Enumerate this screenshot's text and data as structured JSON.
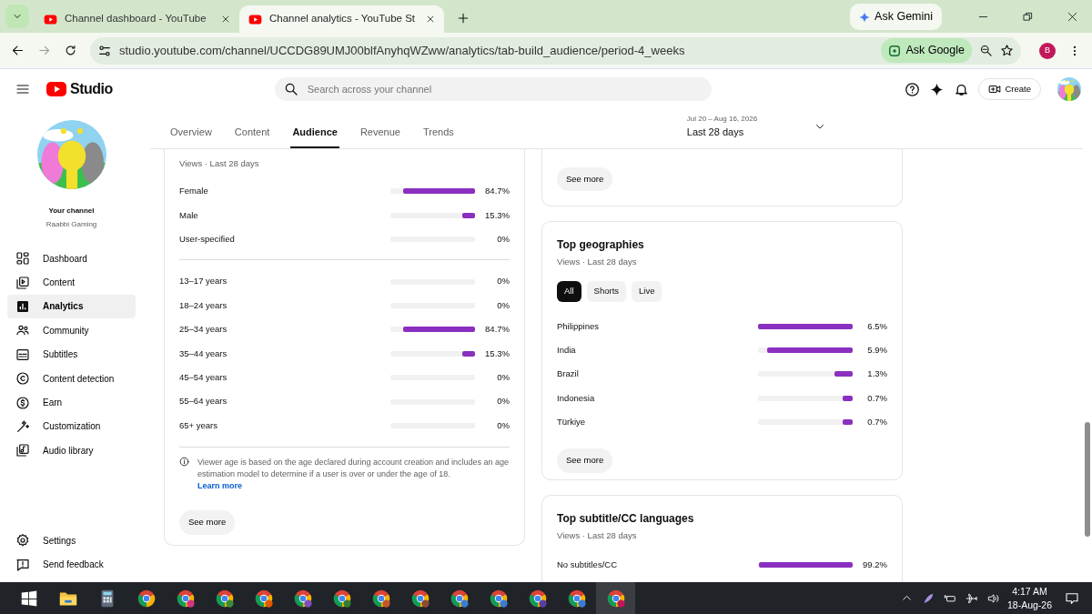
{
  "browser": {
    "tabs": [
      {
        "title": "Channel dashboard - YouTube",
        "selected": false
      },
      {
        "title": "Channel analytics - YouTube St",
        "selected": true
      }
    ],
    "url": "studio.youtube.com/channel/UCCDG89UMJ00blfAnyhqWZww/analytics/tab-build_audience/period-4_weeks",
    "ask_gemini": "Ask Gemini",
    "ask_google": "Ask Google",
    "profile_initial": "B"
  },
  "studio": {
    "logo": "Studio",
    "search": {
      "placeholder": "Search across your channel"
    },
    "create": "Create"
  },
  "sidebar": {
    "channel_label": "Your channel",
    "channel_name": "Raabbi Gaming",
    "items": [
      {
        "label": "Dashboard",
        "selected": false
      },
      {
        "label": "Content",
        "selected": false
      },
      {
        "label": "Analytics",
        "selected": true
      },
      {
        "label": "Community",
        "selected": false
      },
      {
        "label": "Subtitles",
        "selected": false
      },
      {
        "label": "Content detection",
        "selected": false
      },
      {
        "label": "Earn",
        "selected": false
      },
      {
        "label": "Customization",
        "selected": false
      },
      {
        "label": "Audio library",
        "selected": false
      }
    ],
    "footer_items": [
      "Settings",
      "Send feedback"
    ]
  },
  "analytics_tabs": [
    {
      "label": "Overview",
      "selected": false
    },
    {
      "label": "Content",
      "selected": false
    },
    {
      "label": "Audience",
      "selected": true
    },
    {
      "label": "Revenue",
      "selected": false
    },
    {
      "label": "Trends",
      "selected": false
    }
  ],
  "date_range": {
    "range": "Jul 20 – Aug 16, 2026",
    "label": "Last 28 days"
  },
  "age_gender": {
    "subtitle": "Views · Last 28 days",
    "gender": [
      {
        "label": "Female",
        "value": "84.7%",
        "level": 0.847
      },
      {
        "label": "Male",
        "value": "15.3%",
        "level": 0.153
      },
      {
        "label": "User-specified",
        "value": "0%",
        "level": 0
      }
    ],
    "ages": [
      {
        "label": "13–17 years",
        "value": "0%",
        "level": 0
      },
      {
        "label": "18–24 years",
        "value": "0%",
        "level": 0
      },
      {
        "label": "25–34 years",
        "value": "84.7%",
        "level": 0.847
      },
      {
        "label": "35–44 years",
        "value": "15.3%",
        "level": 0.153
      },
      {
        "label": "45–54 years",
        "value": "0%",
        "level": 0
      },
      {
        "label": "55–64 years",
        "value": "0%",
        "level": 0
      },
      {
        "label": "65+ years",
        "value": "0%",
        "level": 0
      }
    ],
    "note": "Viewer age is based on the age declared during account creation and includes an age estimation model to determine if a user is over or under the age of 18.",
    "learn_more": "Learn more",
    "see_more": "See more"
  },
  "upper_card": {
    "see_more": "See more"
  },
  "geographies": {
    "title": "Top geographies",
    "subtitle": "Views · Last 28 days",
    "filters": [
      {
        "label": "All",
        "selected": true
      },
      {
        "label": "Shorts",
        "selected": false
      },
      {
        "label": "Live",
        "selected": false
      }
    ],
    "rows": [
      {
        "label": "Philippines",
        "value": "6.5%",
        "level": 1
      },
      {
        "label": "India",
        "value": "5.9%",
        "level": 0.9
      },
      {
        "label": "Brazil",
        "value": "1.3%",
        "level": 0.19
      },
      {
        "label": "Indonesia",
        "value": "0.7%",
        "level": 0.11
      },
      {
        "label": "Türkiye",
        "value": "0.7%",
        "level": 0.11
      }
    ],
    "see_more": "See more"
  },
  "subtitle_languages": {
    "title": "Top subtitle/CC languages",
    "subtitle": "Views · Last 28 days",
    "rows": [
      {
        "label": "No subtitles/CC",
        "value": "99.2%",
        "level": 0.99
      }
    ]
  },
  "taskbar": {
    "time": "4:17 AM",
    "date": "18-Aug-26"
  }
}
